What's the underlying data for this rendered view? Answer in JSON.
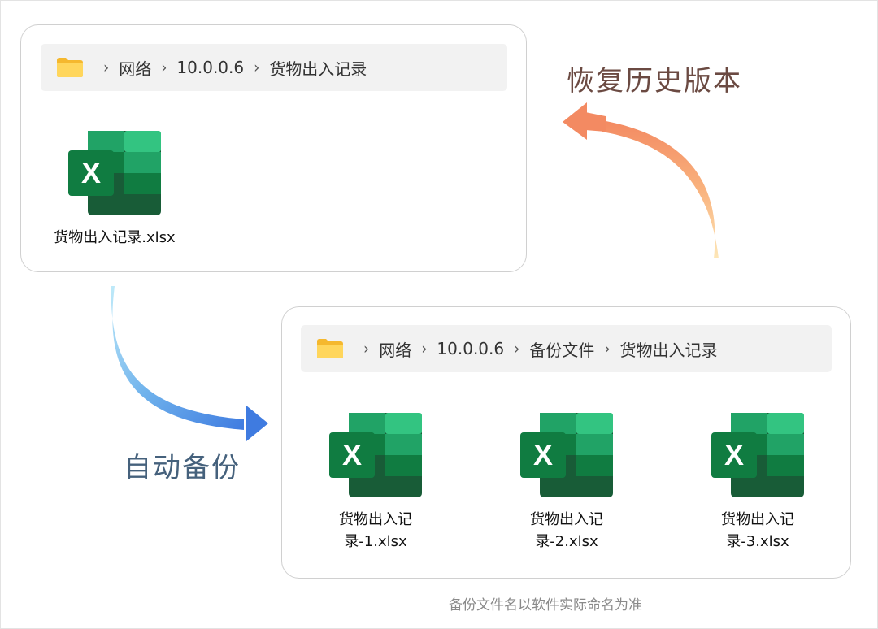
{
  "top_window": {
    "breadcrumb": [
      "网络",
      "10.0.0.6",
      "货物出入记录"
    ],
    "file": {
      "name": "货物出入记录.xlsx",
      "icon": "excel-icon"
    }
  },
  "bottom_window": {
    "breadcrumb": [
      "网络",
      "10.0.0.6",
      "备份文件",
      "货物出入记录"
    ],
    "files": [
      {
        "name": "货物出入记\n录-1.xlsx",
        "icon": "excel-icon"
      },
      {
        "name": "货物出入记\n录-2.xlsx",
        "icon": "excel-icon"
      },
      {
        "name": "货物出入记\n录-3.xlsx",
        "icon": "excel-icon"
      }
    ]
  },
  "labels": {
    "restore": "恢复历史版本",
    "backup": "自动备份"
  },
  "note": "备份文件名以软件实际命名为准",
  "colors": {
    "restore_label": "#6b4a42",
    "backup_label": "#45617c",
    "excel_green": "#21a366",
    "excel_dark": "#107c41",
    "folder_yellow": "#ffc83d"
  }
}
